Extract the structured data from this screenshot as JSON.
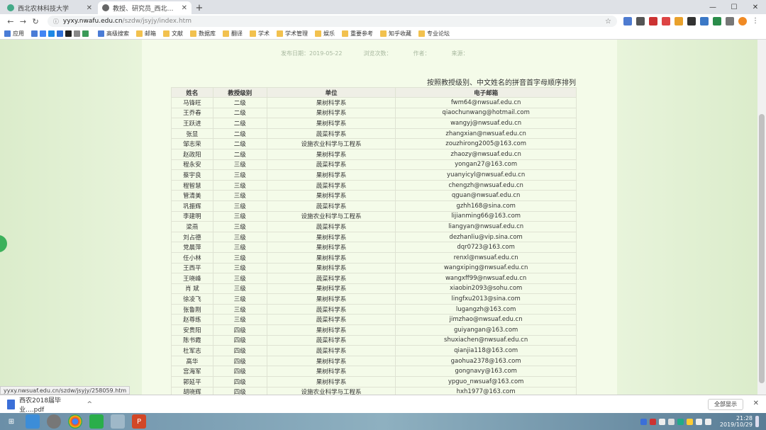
{
  "tabs": [
    {
      "label": "西北农林科技大学"
    },
    {
      "label": "教授、研究员_西北农林科技大学"
    }
  ],
  "address": {
    "domain": "yyxy.nwafu.edu.cn",
    "path": "/szdw/jsyjy/index.htm"
  },
  "bookmarks": [
    "应用",
    "高级搜索",
    "邮箱",
    "文献",
    "数据库",
    "翻译",
    "学术",
    "学术管理",
    "娱乐",
    "重要参考",
    "知乎收藏",
    "专业论坛"
  ],
  "meta": {
    "date": "发布日期：2019-05-22",
    "views": "浏览次数：",
    "author": "作者：",
    "source": "来源："
  },
  "note": "按照教授级别、中文姓名的拼音首字母顺序排列",
  "table": {
    "headers": [
      "姓名",
      "教授级别",
      "单位",
      "电子邮箱"
    ],
    "rows": [
      [
        "马锋旺",
        "二级",
        "果树科学系",
        "fwm64@nwsuaf.edu.cn"
      ],
      [
        "王乔春",
        "二级",
        "果树科学系",
        "qiaochunwang@hotmail.com"
      ],
      [
        "王跃进",
        "二级",
        "果树科学系",
        "wangyj@nwsuaf.edu.cn"
      ],
      [
        "张显",
        "二级",
        "蔬菜科学系",
        "zhangxian@nwsuaf.edu.cn"
      ],
      [
        "邹志荣",
        "二级",
        "设施农业科学与工程系",
        "zouzhirong2005@163.com"
      ],
      [
        "赵政阳",
        "二级",
        "果树科学系",
        "zhaozy@nwsuaf.edu.cn"
      ],
      [
        "程永安",
        "三级",
        "蔬菜科学系",
        "yongan27@163.com"
      ],
      [
        "蔡宇良",
        "三级",
        "果树科学系",
        "yuanyicyl@nwsuaf.edu.cn"
      ],
      [
        "程智慧",
        "三级",
        "蔬菜科学系",
        "chengzh@nwsuaf.edu.cn"
      ],
      [
        "管清美",
        "三级",
        "果树科学系",
        "qguan@nwsuaf.edu.cn"
      ],
      [
        "巩振辉",
        "三级",
        "蔬菜科学系",
        "gzhh168@sina.com"
      ],
      [
        "李建明",
        "三级",
        "设施农业科学与工程系",
        "lijianming66@163.com"
      ],
      [
        "梁燕",
        "三级",
        "蔬菜科学系",
        "liangyan@nwsuaf.edu.cn"
      ],
      [
        "刘占德",
        "三级",
        "果树科学系",
        "dezhanliu@vip.sina.com"
      ],
      [
        "党晨萍",
        "三级",
        "果树科学系",
        "dqr0723@163.com"
      ],
      [
        "任小林",
        "三级",
        "果树科学系",
        "renxl@nwsuaf.edu.cn"
      ],
      [
        "王西平",
        "三级",
        "果树科学系",
        "wangxiping@nwsuaf.edu.cn"
      ],
      [
        "王晓峰",
        "三级",
        "蔬菜科学系",
        "wangxff99@nwsuaf.edu.cn"
      ],
      [
        "肖 斌",
        "三级",
        "果树科学系",
        "xiaobin2093@sohu.com"
      ],
      [
        "徐凌飞",
        "三级",
        "果树科学系",
        "lingfxu2013@sina.com"
      ],
      [
        "张鲁刚",
        "三级",
        "蔬菜科学系",
        "lugangzh@163.com"
      ],
      [
        "赵尊练",
        "三级",
        "蔬菜科学系",
        "jimzhao@nwsuaf.edu.cn"
      ],
      [
        "安贵阳",
        "四级",
        "果树科学系",
        "guiyangan@163.com"
      ],
      [
        "陈书霞",
        "四级",
        "蔬菜科学系",
        "shuxiachen@nwsuaf.edu.cn"
      ],
      [
        "杜军志",
        "四级",
        "蔬菜科学系",
        "qianjia118@163.com"
      ],
      [
        "高华",
        "四级",
        "果树科学系",
        "gaohua2378@163.com"
      ],
      [
        "宫海军",
        "四级",
        "果树科学系",
        "gongnavy@163.com"
      ],
      [
        "郭延平",
        "四级",
        "果树科学系",
        "ypguo_nwsuaf@163.com"
      ],
      [
        "胡晓辉",
        "四级",
        "设施农业科学与工程系",
        "hxh1977@163.com"
      ]
    ]
  },
  "status_url": "yyxy.nwsuaf.edu.cn/szdw/jsyjy/258059.htm",
  "download": {
    "filename": "西农2018届毕业....pdf",
    "show_all": "全部显示"
  },
  "clock": {
    "time": "21:28",
    "date": "2019/10/29"
  },
  "colors": {
    "page_bg": "#e6f2d8",
    "content_bg": "#f4fbe9",
    "header_bg": "#efefe6"
  }
}
